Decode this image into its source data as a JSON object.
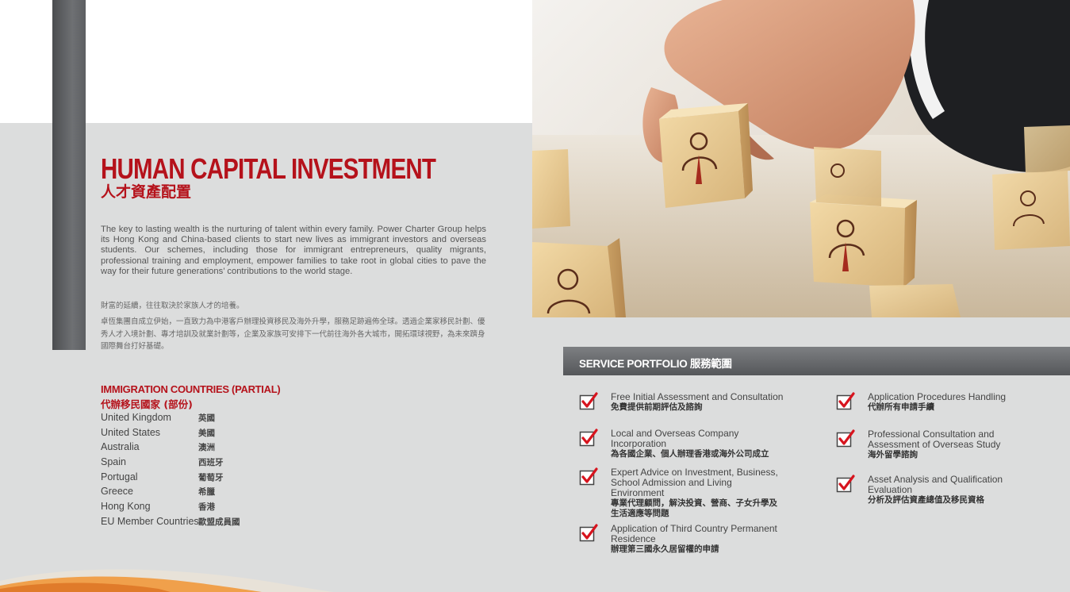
{
  "header": {
    "title_en": "HUMAN CAPITAL INVESTMENT",
    "title_zh": "人才資產配置"
  },
  "intro": {
    "en": "The key to lasting wealth is the nurturing of talent within every family. Power Charter Group helps its Hong Kong and China-based clients to start new lives as immigrant investors and overseas students. Our schemes, including those for immigrant entrepreneurs, quality migrants, professional training and employment, empower families to take root in global cities to pave the way for their future generations’ contributions to the world stage.",
    "zh_lead": "財富的延續，往往取決於家族人才的培養。",
    "zh_body": "卓恆集團自成立伊始，一直致力為中港客戶辦理投資移民及海外升學，服務足跡遍佈全球。透過企業家移民計劃、優秀人才入境計劃、專才培訓及就業計劃等，企業及家族可安排下一代前往海外各大城市，開拓環球視野，為未來躋身國際舞台打好基礎。"
  },
  "countries": {
    "title_en": "IMMIGRATION COUNTRIES (PARTIAL)",
    "title_zh": "代辦移民國家 (部份)",
    "items": [
      {
        "en": "United Kingdom",
        "zh": "英國"
      },
      {
        "en": "United States",
        "zh": "美國"
      },
      {
        "en": "Australia",
        "zh": "澳洲"
      },
      {
        "en": "Spain",
        "zh": "西班牙"
      },
      {
        "en": "Portugal",
        "zh": "葡萄牙"
      },
      {
        "en": "Greece",
        "zh": "希臘"
      },
      {
        "en": "Hong Kong",
        "zh": "香港"
      },
      {
        "en": "EU Member Countries",
        "zh": "歐盟成員國"
      }
    ]
  },
  "services": {
    "title": "SERVICE PORTFOLIO 服務範圍",
    "items": [
      {
        "en": "Free Initial Assessment and Consultation",
        "zh": "免費提供前期評估及諮詢"
      },
      {
        "en": "Local and Overseas Company Incorporation",
        "zh": "為各國企業、個人辦理香港或海外公司成立"
      },
      {
        "en": "Expert Advice on Investment, Business, School Admission and Living Environment",
        "zh": "專業代理顧問，解決投資、營商、子女升學及生活適應等問題"
      },
      {
        "en": "Application of Third Country Permanent Residence",
        "zh": "辦理第三國永久居留權的申請"
      },
      {
        "en": "Application Procedures Handling",
        "zh": "代辦所有申請手續"
      },
      {
        "en": "Professional Consultation and Assessment of Overseas Study",
        "zh": "海外留學諮詢"
      },
      {
        "en": "Asset Analysis and Qualification Evaluation",
        "zh": "分析及評估資產總值及移民資格"
      }
    ]
  },
  "icons": {
    "checkbox": "red-checkmark-icon"
  },
  "colors": {
    "accent_red": "#b5121b",
    "background": "#dcdddd",
    "bar_gray": "#5d5f62"
  }
}
